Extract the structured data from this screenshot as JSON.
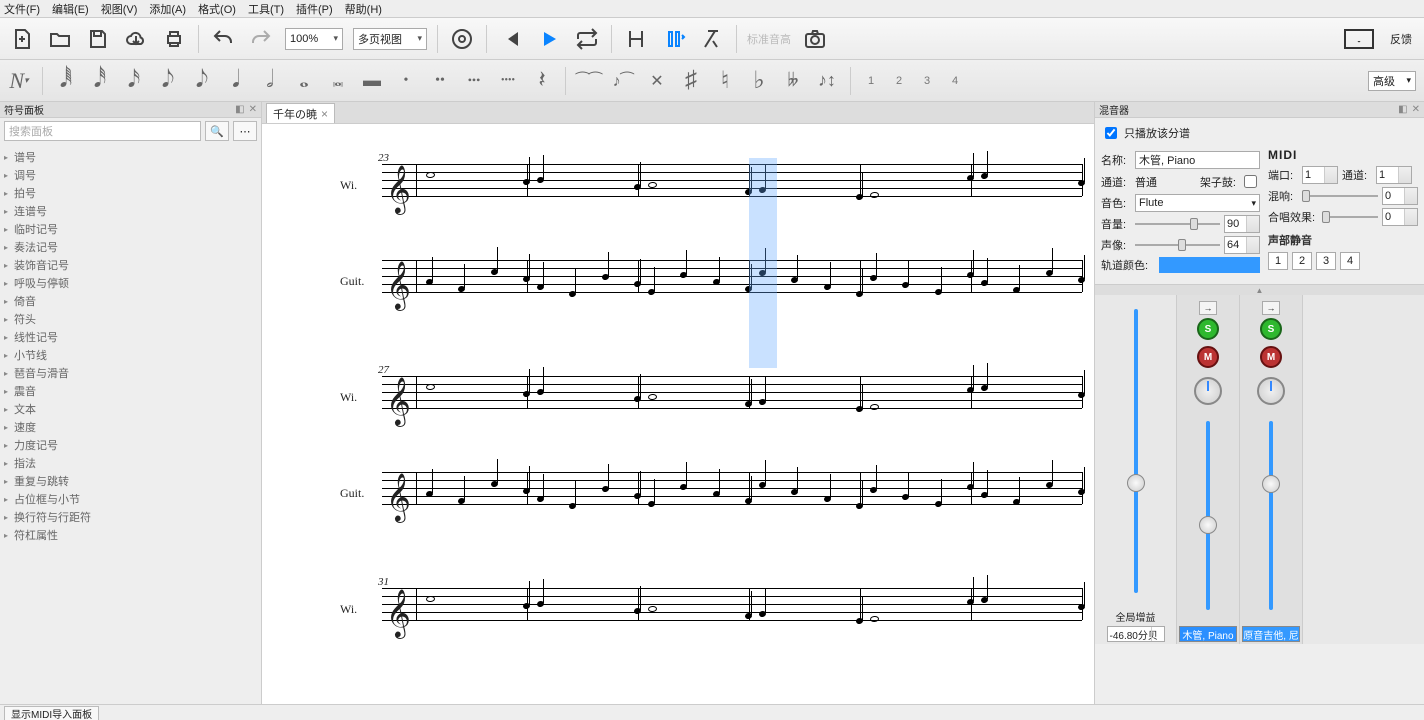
{
  "menus": [
    "文件(F)",
    "编辑(E)",
    "视图(V)",
    "添加(A)",
    "格式(O)",
    "工具(T)",
    "插件(P)",
    "帮助(H)"
  ],
  "toolbar": {
    "zoom": "100%",
    "layout": "多页视图",
    "pitch_placeholder": "标准音高",
    "feedback": "反馈"
  },
  "note_toolbar": {
    "voices": [
      "1",
      "2",
      "3",
      "4"
    ],
    "advanced": "高级"
  },
  "palette": {
    "title": "符号面板",
    "search_placeholder": "搜索面板",
    "items": [
      "谱号",
      "调号",
      "拍号",
      "连谱号",
      "临时记号",
      "奏法记号",
      "装饰音记号",
      "呼吸与停顿",
      "倚音",
      "符头",
      "线性记号",
      "小节线",
      "琶音与滑音",
      "震音",
      "文本",
      "速度",
      "力度记号",
      "指法",
      "重复与跳转",
      "占位框与小节",
      "换行符与行距符",
      "符杠属性"
    ]
  },
  "tab": {
    "title": "千年の暁"
  },
  "score": {
    "systems": [
      {
        "measure": "23",
        "insts": [
          "Wi.",
          "Guit."
        ]
      },
      {
        "measure": "27",
        "insts": [
          "Wi.",
          "Guit."
        ]
      },
      {
        "measure": "31",
        "insts": [
          "Wi."
        ]
      }
    ]
  },
  "status": {
    "midi": "显示MIDI导入面板"
  },
  "mixer": {
    "title": "混音器",
    "play_part_only": "只播放该分谱",
    "labels": {
      "name": "名称:",
      "channel": "通道:",
      "drumset": "架子鼓:",
      "sound": "音色:",
      "volume": "音量:",
      "pan": "声像:",
      "track_color": "轨道颜色:"
    },
    "name": "木管, Piano",
    "channel_value": "普通",
    "sound": "Flute",
    "volume": "90",
    "pan": "64",
    "midi": {
      "title": "MIDI",
      "port": "端口:",
      "port_v": "1",
      "chan": "通道:",
      "chan_v": "1",
      "reverb": "混响:",
      "reverb_v": "0",
      "chorus": "合唱效果:",
      "chorus_v": "0"
    },
    "voice_mute": {
      "title": "声部静音",
      "btns": [
        "1",
        "2",
        "3",
        "4"
      ]
    },
    "master": {
      "label": "全局增益",
      "value": "-46.80分贝"
    },
    "channels": [
      {
        "label": "木管, Piano",
        "selected": true
      },
      {
        "label": "原音吉他, 尼",
        "selected": false
      }
    ]
  }
}
